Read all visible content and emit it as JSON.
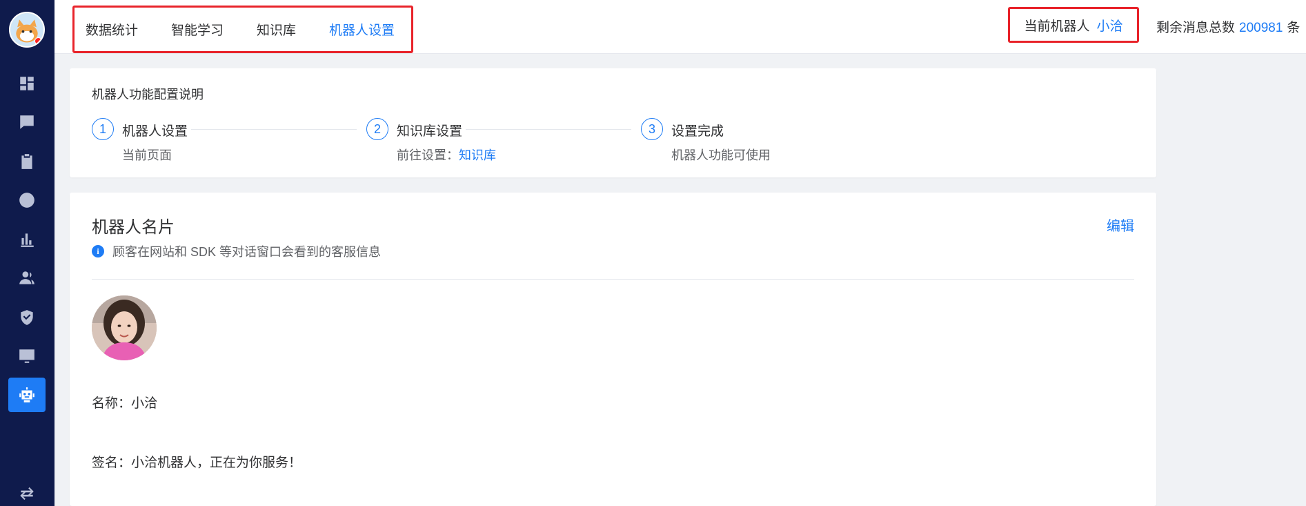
{
  "topbar": {
    "tabs": [
      "数据统计",
      "智能学习",
      "知识库",
      "机器人设置"
    ],
    "current_robot_label": "当前机器人",
    "current_robot_name": "小洽",
    "msg_label": "剩余消息总数",
    "msg_count": "200981",
    "msg_unit": "条"
  },
  "sidebar": {
    "items": [
      "dashboard-icon",
      "chat-icon",
      "clipboard-icon",
      "clock-icon",
      "bar-chart-icon",
      "users-icon",
      "shield-icon",
      "monitor-chart-icon",
      "robot-icon",
      "swap-icon"
    ],
    "active": "robot-icon"
  },
  "steps": {
    "title": "机器人功能配置说明",
    "items": [
      {
        "num": "1",
        "title": "机器人设置",
        "desc": "当前页面"
      },
      {
        "num": "2",
        "title": "知识库设置",
        "desc": "前往设置：",
        "link": "知识库"
      },
      {
        "num": "3",
        "title": "设置完成",
        "desc": "机器人功能可使用"
      }
    ]
  },
  "robot_card": {
    "title": "机器人名片",
    "edit_label": "编辑",
    "info": "顾客在网站和 SDK 等对话窗口会看到的客服信息",
    "name_label": "名称：",
    "name_value": "小洽",
    "signature_label": "签名：",
    "signature_value": "小洽机器人，正在为你服务！"
  },
  "colors": {
    "accent": "#1e7cf5",
    "sidebar": "#0f1b4c",
    "highlight_border": "#e8232a"
  }
}
